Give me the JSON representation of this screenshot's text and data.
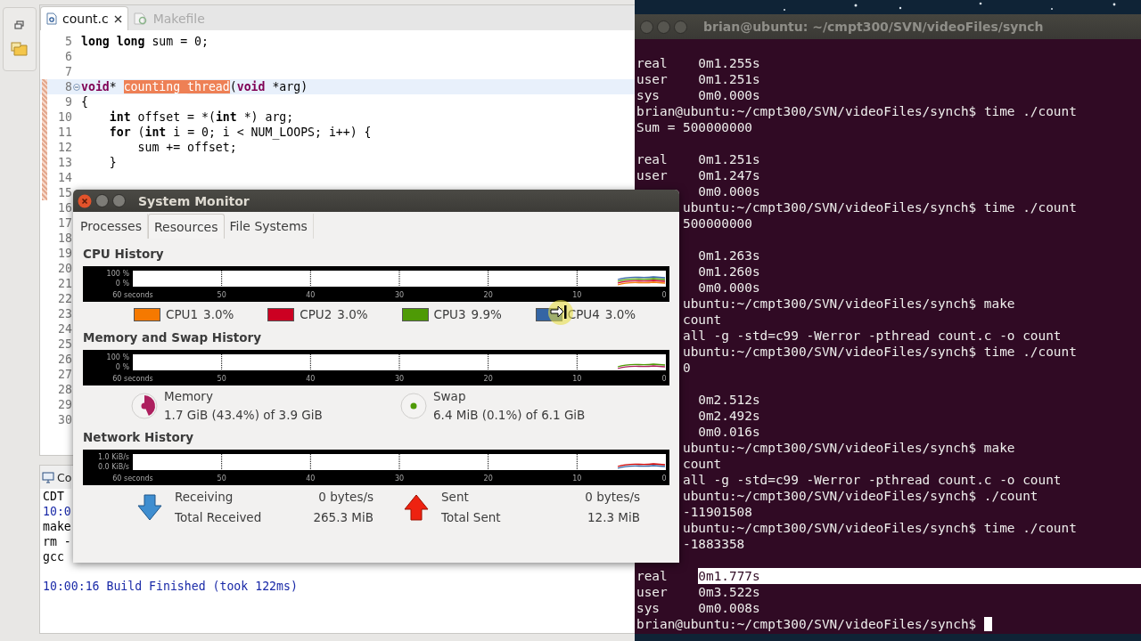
{
  "editor": {
    "tabs": [
      {
        "label": "count.c",
        "selected": true
      },
      {
        "label": "Makefile",
        "selected": false
      }
    ],
    "lines": [
      {
        "number": "5",
        "current": false,
        "changed": false,
        "text": "**long long** sum = 0;"
      },
      {
        "number": "6",
        "current": false,
        "changed": false
      },
      {
        "number": "7",
        "current": false,
        "changed": false
      },
      {
        "number": "8",
        "current": true,
        "changed": true,
        "parts": [
          {
            "kind": "keyword",
            "t": "void"
          },
          {
            "kind": "plain",
            "t": "* "
          },
          {
            "kind": "mark",
            "t": "counting_thread"
          },
          {
            "kind": "plain",
            "t": "("
          },
          {
            "kind": "keyword",
            "t": "void"
          },
          {
            "kind": "plain",
            "t": " *arg)"
          }
        ]
      },
      {
        "number": "9",
        "current": false,
        "changed": true,
        "text": "{"
      },
      {
        "number": "10",
        "current": false,
        "changed": true,
        "text": "    **int** offset = *(**int** *) arg;"
      },
      {
        "number": "11",
        "current": false,
        "changed": true,
        "text": "    **for** (**int** i = 0; i < NUM_LOOPS; i++) {"
      },
      {
        "number": "12",
        "current": false,
        "changed": true,
        "text": "        sum += offset;"
      },
      {
        "number": "13",
        "current": false,
        "changed": true,
        "text": "    }"
      },
      {
        "number": "14",
        "current": false,
        "changed": true
      },
      {
        "number": "15",
        "current": false,
        "changed": true
      },
      {
        "number": "16",
        "current": false,
        "changed": false
      },
      {
        "number": "17",
        "current": false,
        "changed": false
      },
      {
        "number": "18",
        "current": false,
        "changed": false
      },
      {
        "number": "19",
        "current": false,
        "changed": false
      },
      {
        "number": "20",
        "current": false,
        "changed": false
      },
      {
        "number": "21",
        "current": false,
        "changed": false
      },
      {
        "number": "22",
        "current": false,
        "changed": false
      },
      {
        "number": "23",
        "current": false,
        "changed": false
      },
      {
        "number": "24",
        "current": false,
        "changed": false
      },
      {
        "number": "25",
        "current": false,
        "changed": false
      },
      {
        "number": "26",
        "current": false,
        "changed": false
      },
      {
        "number": "27",
        "current": false,
        "changed": false
      },
      {
        "number": "28",
        "current": false,
        "changed": false
      },
      {
        "number": "29",
        "current": false,
        "changed": false
      },
      {
        "number": "30",
        "current": false,
        "changed": false
      }
    ]
  },
  "console": {
    "tab": "Co",
    "lines": [
      {
        "kind": "plain",
        "text": "CDT"
      },
      {
        "kind": "info",
        "text": "10:0"
      },
      {
        "kind": "plain",
        "text": "make"
      },
      {
        "kind": "plain",
        "text": "rm -"
      },
      {
        "kind": "plain",
        "text": "gcc"
      },
      {
        "kind": "status",
        "text": "10:00:16 Build Finished (took 122ms)"
      }
    ]
  },
  "terminal": {
    "title": "brian@ubuntu: ~/cmpt300/SVN/videoFiles/synch",
    "lines": [
      {
        "kind": "blank"
      },
      {
        "kind": "text",
        "text": "real    0m1.255s"
      },
      {
        "kind": "text",
        "text": "user    0m1.251s"
      },
      {
        "kind": "text",
        "text": "sys     0m0.000s"
      },
      {
        "kind": "text",
        "text": "brian@ubuntu:~/cmpt300/SVN/videoFiles/synch$ time ./count"
      },
      {
        "kind": "text",
        "text": "Sum = 500000000"
      },
      {
        "kind": "blank"
      },
      {
        "kind": "text",
        "text": "real    0m1.251s"
      },
      {
        "kind": "text",
        "text": "user    0m1.247s"
      },
      {
        "kind": "text",
        "text": "        0m0.000s"
      },
      {
        "kind": "text",
        "text": "      ubuntu:~/cmpt300/SVN/videoFiles/synch$ time ./count"
      },
      {
        "kind": "text",
        "text": "      500000000"
      },
      {
        "kind": "blank"
      },
      {
        "kind": "text",
        "text": "        0m1.263s"
      },
      {
        "kind": "text",
        "text": "        0m1.260s"
      },
      {
        "kind": "text",
        "text": "        0m0.000s"
      },
      {
        "kind": "text",
        "text": "      ubuntu:~/cmpt300/SVN/videoFiles/synch$ make"
      },
      {
        "kind": "text",
        "text": "      count"
      },
      {
        "kind": "text",
        "text": "      all -g -std=c99 -Werror -pthread count.c -o count"
      },
      {
        "kind": "text",
        "text": "      ubuntu:~/cmpt300/SVN/videoFiles/synch$ time ./count"
      },
      {
        "kind": "text",
        "text": "      0"
      },
      {
        "kind": "blank"
      },
      {
        "kind": "text",
        "text": "        0m2.512s"
      },
      {
        "kind": "text",
        "text": "        0m2.492s"
      },
      {
        "kind": "text",
        "text": "        0m0.016s"
      },
      {
        "kind": "text",
        "text": "      ubuntu:~/cmpt300/SVN/videoFiles/synch$ make"
      },
      {
        "kind": "text",
        "text": "      count"
      },
      {
        "kind": "text",
        "text": "      all -g -std=c99 -Werror -pthread count.c -o count"
      },
      {
        "kind": "text",
        "text": "      ubuntu:~/cmpt300/SVN/videoFiles/synch$ ./count"
      },
      {
        "kind": "text",
        "text": "      -11901508"
      },
      {
        "kind": "text",
        "text": "      ubuntu:~/cmpt300/SVN/videoFiles/synch$ time ./count"
      },
      {
        "kind": "text",
        "text": "      -1883358"
      },
      {
        "kind": "blank"
      },
      {
        "kind": "selection",
        "text": "real    ",
        "selected_text": "0m1.777s"
      },
      {
        "kind": "text",
        "text": "user    0m3.522s"
      },
      {
        "kind": "text",
        "text": "sys     0m0.008s"
      },
      {
        "kind": "input",
        "text": "brian@ubuntu:~/cmpt300/SVN/videoFiles/synch$ "
      }
    ]
  },
  "monitor": {
    "title": "System Monitor",
    "tabs": [
      {
        "label": "Processes",
        "selected": false
      },
      {
        "label": "Resources",
        "selected": true
      },
      {
        "label": "File Systems",
        "selected": false
      }
    ],
    "sections": [
      {
        "kind": "cpu",
        "heading": "CPU History",
        "graph": {
          "y_labels": [
            "100 %",
            "0 %"
          ],
          "x_labels": [
            "60 seconds",
            "50",
            "40",
            "30",
            "20",
            "10",
            "0"
          ]
        },
        "legend": [
          {
            "label": "CPU1",
            "reading": "3.0%",
            "color": "#f57900"
          },
          {
            "label": "CPU2",
            "reading": "3.0%",
            "color": "#cc0022"
          },
          {
            "label": "CPU3",
            "reading": "9.9%",
            "color": "#4e9a06"
          },
          {
            "label": "CPU4",
            "reading": "3.0%",
            "color": "#3465a4"
          }
        ]
      },
      {
        "kind": "memory",
        "heading": "Memory and Swap History",
        "graph": {
          "y_labels": [
            "100 %",
            "0 %"
          ],
          "x_labels": [
            "60 seconds",
            "50",
            "40",
            "30",
            "20",
            "10",
            "0"
          ]
        },
        "items": [
          {
            "label": "Memory",
            "detail": "1.7 GiB (43.4%) of 3.9 GiB",
            "level": 0.434,
            "color": "#ad1f5e"
          },
          {
            "label": "Swap",
            "detail": "6.4 MiB (0.1%) of 6.1 GiB",
            "color": "#4e9a06"
          }
        ]
      },
      {
        "kind": "network",
        "heading": "Network History",
        "graph": {
          "y_labels": [
            "1.0 KiB/s",
            "0.0 KiB/s"
          ],
          "x_labels": [
            "60 seconds",
            "50",
            "40",
            "30",
            "20",
            "10",
            "0"
          ]
        },
        "items": [
          {
            "kind": "download",
            "label": "Receiving",
            "rate": "0 bytes/s",
            "total_label": "Total Received",
            "total": "265.3 MiB"
          },
          {
            "kind": "upload",
            "label": "Sent",
            "rate": "0 bytes/s",
            "total_label": "Total Sent",
            "total": "12.3 MiB"
          }
        ]
      }
    ]
  }
}
